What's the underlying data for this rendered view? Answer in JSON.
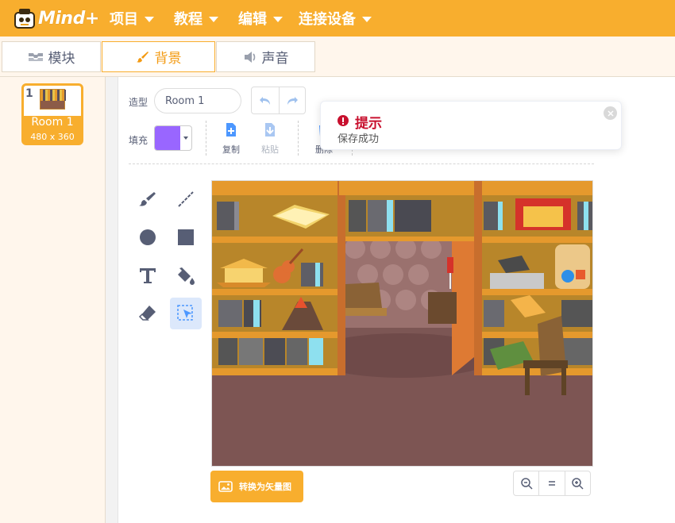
{
  "menu": {
    "logo": "Mind+",
    "items": [
      {
        "label": "项目"
      },
      {
        "label": "教程"
      },
      {
        "label": "编辑"
      },
      {
        "label": "连接设备"
      }
    ]
  },
  "tabs": [
    {
      "label": "模块",
      "icon": "blocks-icon",
      "active": false
    },
    {
      "label": "背景",
      "icon": "brush-icon",
      "active": true
    },
    {
      "label": "声音",
      "icon": "speaker-icon",
      "active": false
    }
  ],
  "costumes": [
    {
      "index": "1",
      "name": "Room 1",
      "size": "480 x 360",
      "selected": true
    }
  ],
  "editor": {
    "costume_label": "造型",
    "costume_name": "Room 1",
    "fill_label": "填充",
    "fill_color": "#9966ff",
    "actions": {
      "copy": "复制",
      "paste": "粘贴",
      "delete": "删除"
    },
    "convert_button": "转换为矢量图",
    "zoom": {
      "out": "zoom-out-icon",
      "reset": "zoom-reset-icon",
      "in": "zoom-in-icon"
    }
  },
  "toast": {
    "title": "提示",
    "message": "保存成功"
  },
  "colors": {
    "brand": "#f8ae2e",
    "accent_text": "#f39a12",
    "alert": "#c8102e",
    "fill": "#9966ff"
  }
}
